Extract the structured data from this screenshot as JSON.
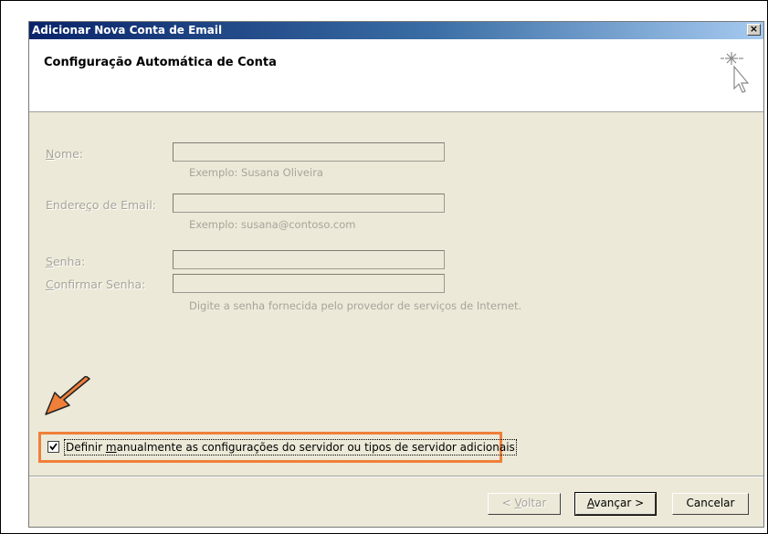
{
  "window": {
    "title": "Adicionar Nova Conta de Email",
    "close_symbol": "×"
  },
  "header": {
    "title": "Configuração Automática de Conta",
    "icon": "wizard-cursor-sparkle-icon"
  },
  "form": {
    "name": {
      "label_underlined": "N",
      "label_rest": "ome:",
      "value": "",
      "hint": "Exemplo: Susana Oliveira"
    },
    "email": {
      "label_prefix": "Endere",
      "label_underlined": "ç",
      "label_rest": "o de Email:",
      "value": "",
      "hint": "Exemplo: susana@contoso.com"
    },
    "password": {
      "label_underlined": "S",
      "label_rest": "enha:",
      "value": ""
    },
    "confirm_password": {
      "label_underlined": "C",
      "label_rest": "onfirmar Senha:",
      "value": "",
      "hint": "Digite a senha fornecida pelo provedor de serviços de Internet."
    }
  },
  "manual_config": {
    "checked": true,
    "label_prefix": "Definir ",
    "label_underlined": "m",
    "label_rest": "anualmente as configurações do servidor ou tipos de servidor adicionais",
    "highlight_color": "#f07f3a"
  },
  "buttons": {
    "back": {
      "prefix": "< ",
      "underlined": "V",
      "rest": "oltar",
      "enabled": false
    },
    "next": {
      "underlined": "A",
      "rest": "vançar >",
      "enabled": true
    },
    "cancel": {
      "label": "Cancelar",
      "enabled": true
    }
  },
  "colors": {
    "dialog_bg": "#ece9d8",
    "titlebar_start": "#0a246a",
    "titlebar_end": "#a6caf0",
    "annotation_arrow": "#f07f3a"
  }
}
